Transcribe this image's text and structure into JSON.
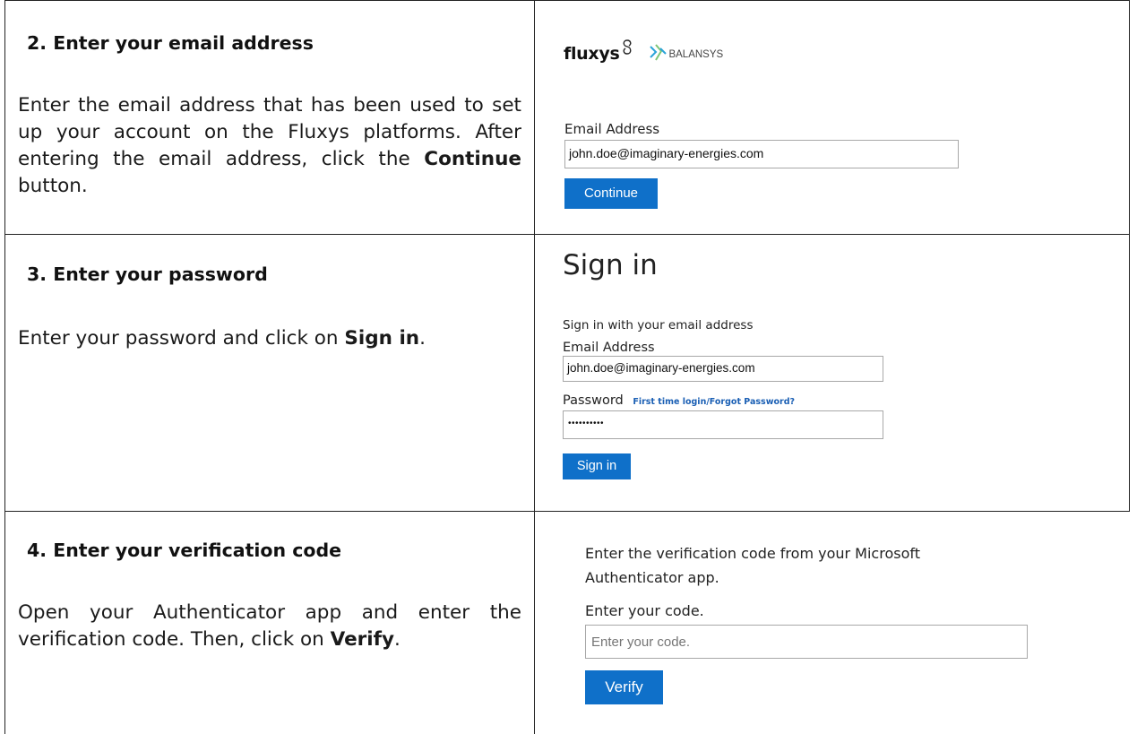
{
  "steps": [
    {
      "title": "2.  Enter your email address",
      "text_before": "Enter the email address that has been used to set up your account on the Fluxys platforms. After entering the email address, click the ",
      "text_bold": "Continue",
      "text_after": " button.",
      "panel": {
        "brand_fluxys": "fluxys",
        "brand_balansys": "BALANSYS",
        "email_label": "Email Address",
        "email_value": "john.doe@imaginary-energies.com",
        "button_label": "Continue"
      }
    },
    {
      "title": "3.  Enter your password",
      "text_before": "Enter your password and click on ",
      "text_bold": "Sign in",
      "text_after": ".",
      "panel": {
        "heading": "Sign in",
        "subheading": "Sign in with your email address",
        "email_label": "Email Address",
        "email_value": "john.doe@imaginary-energies.com",
        "password_label": "Password",
        "forgot_link": "First time login/Forgot Password?",
        "password_value": "••••••••••",
        "button_label": "Sign in"
      }
    },
    {
      "title": "4.  Enter your verification code",
      "text_before": "Open your Authenticator app and enter the verification code. Then, click on ",
      "text_bold": "Verify",
      "text_after": ".",
      "panel": {
        "instruction": "Enter the verification code from your Microsoft Authenticator app.",
        "code_label": "Enter your code.",
        "code_placeholder": "Enter your code.",
        "button_label": "Verify"
      }
    }
  ],
  "colors": {
    "button": "#0f70c9",
    "link": "#1a5fb4",
    "balansys_icon": "#2aa3d8"
  },
  "icons": [
    "fluxys-swirl-icon",
    "balansys-logo-icon"
  ]
}
